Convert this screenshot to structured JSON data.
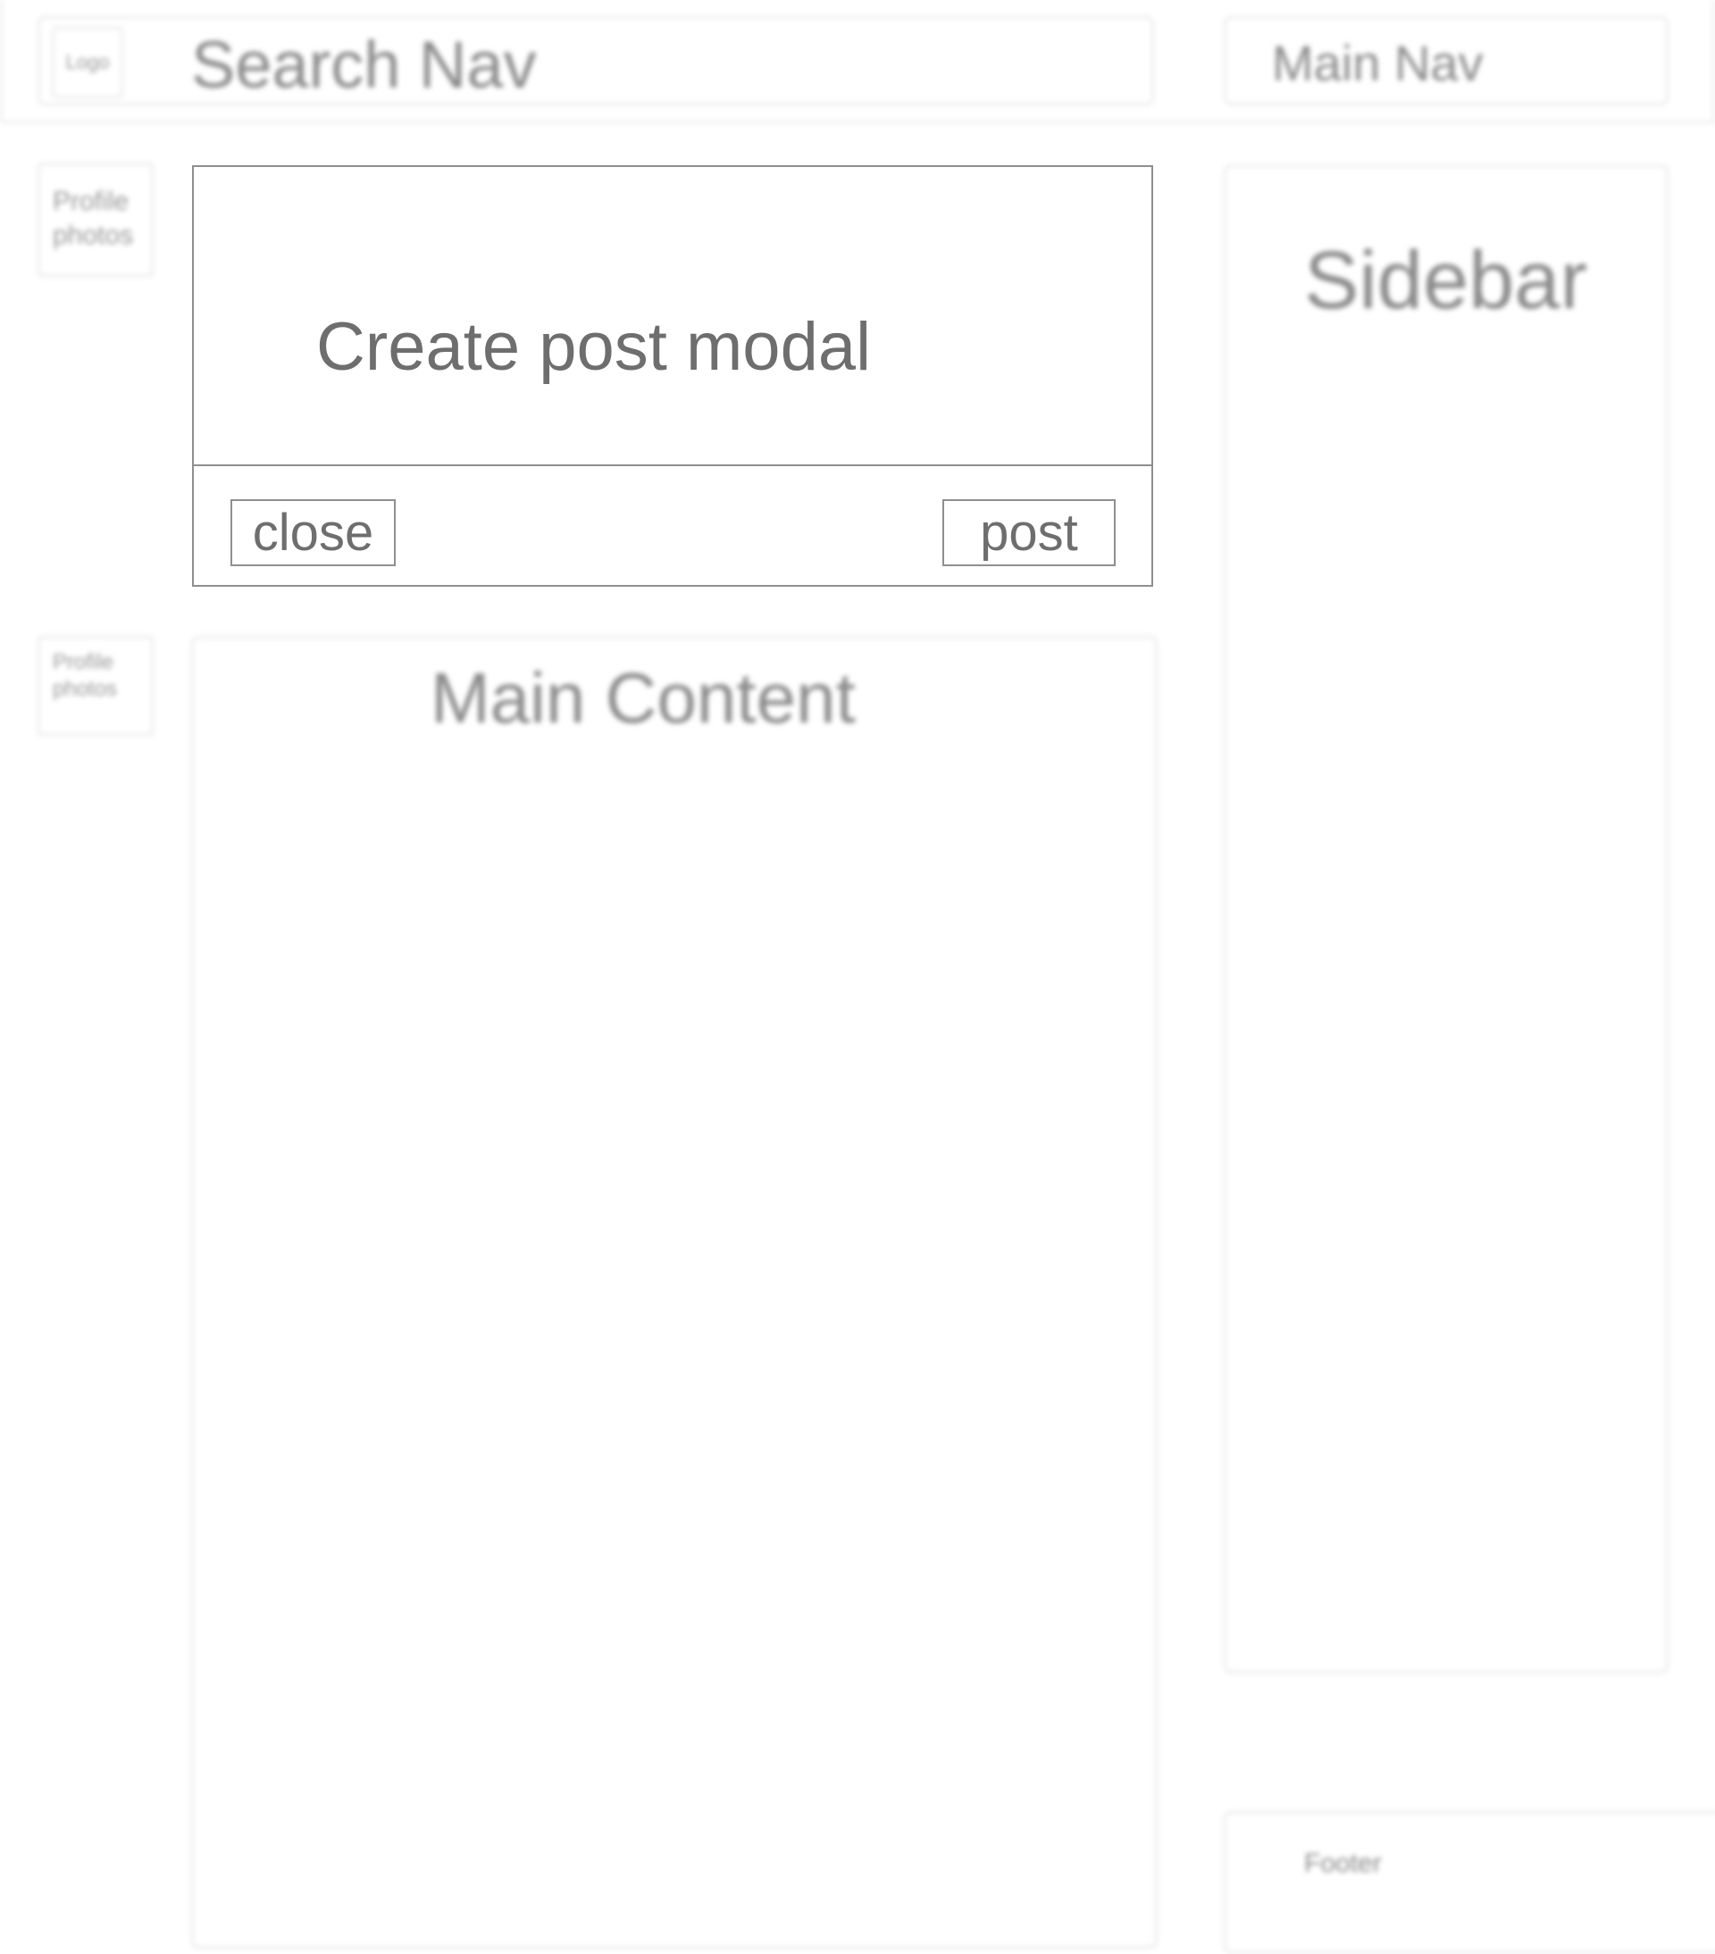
{
  "header": {
    "logo_label": "Logo",
    "search_nav_label": "Search Nav",
    "main_nav_label": "Main Nav"
  },
  "profile_photos": [
    {
      "label": "Profile photos"
    },
    {
      "label": "Profile photos"
    }
  ],
  "modal": {
    "title": "Create post modal",
    "close_label": "close",
    "post_label": "post"
  },
  "main_content": {
    "label": "Main Content"
  },
  "sidebar": {
    "label": "Sidebar"
  },
  "footer": {
    "label": "Footer"
  },
  "colors": {
    "text_sharp": "#6e6e6e",
    "text_blurred": "#8a8a8a",
    "border_sharp": "#8f8f8f",
    "border_blurred": "#ececec",
    "background": "#ffffff"
  }
}
